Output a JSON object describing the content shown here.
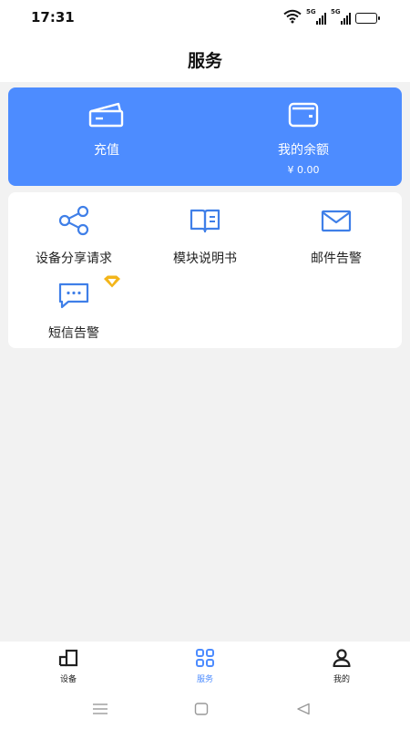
{
  "status_bar": {
    "time": "17:31",
    "signal_1_label": "5G",
    "signal_2_label": "5G",
    "icons": [
      "wifi-icon",
      "signal-icon",
      "signal-icon",
      "battery-icon"
    ]
  },
  "header": {
    "title": "服务"
  },
  "wallet": {
    "recharge_label": "充值",
    "balance_label": "我的余额",
    "balance_amount": "¥ 0.00",
    "icons": [
      "recharge-icon",
      "wallet-icon"
    ]
  },
  "services": [
    {
      "label": "设备分享请求",
      "icon": "share-icon"
    },
    {
      "label": "模块说明书",
      "icon": "book-icon"
    },
    {
      "label": "邮件告警",
      "icon": "mail-icon"
    },
    {
      "label": "短信告警",
      "icon": "sms-icon",
      "badge": "vip-diamond-icon"
    }
  ],
  "bottom_nav": {
    "items": [
      {
        "label": "设备",
        "icon": "device-icon",
        "active": false
      },
      {
        "label": "服务",
        "icon": "grid-icon",
        "active": true
      },
      {
        "label": "我的",
        "icon": "user-icon",
        "active": false
      }
    ]
  },
  "system_nav": {
    "icons": [
      "menu-icon",
      "home-icon",
      "back-icon"
    ]
  },
  "colors": {
    "accent": "#4d8cff",
    "icon_blue": "#3f7fe8",
    "badge_gold": "#f3b51a",
    "background": "#f2f2f2"
  }
}
